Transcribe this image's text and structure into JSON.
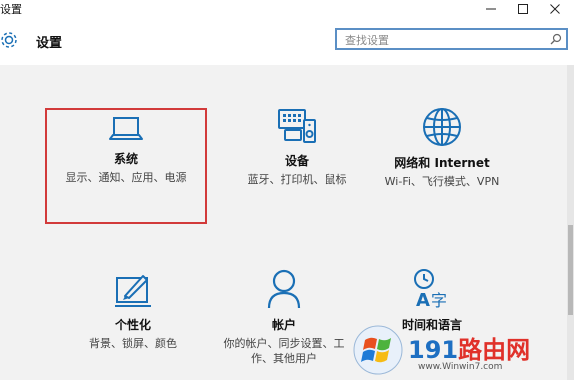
{
  "window": {
    "title": "设置",
    "minimize_icon": "minimize-icon",
    "maximize_icon": "maximize-icon",
    "close_icon": "close-icon"
  },
  "header": {
    "icon": "gear-icon",
    "title": "设置"
  },
  "search": {
    "placeholder": "查找设置",
    "icon": "search-icon",
    "border_color": "#5b8fc5"
  },
  "accent": "#1a6fb5",
  "tiles": [
    {
      "icon": "laptop-icon",
      "label": "系统",
      "desc": "显示、通知、应用、电源",
      "highlighted": true,
      "highlight_color": "#d23a3a"
    },
    {
      "icon": "devices-icon",
      "label": "设备",
      "desc": "蓝牙、打印机、鼠标"
    },
    {
      "icon": "globe-icon",
      "label": "网络和 Internet",
      "desc": "Wi-Fi、飞行模式、VPN"
    },
    {
      "icon": "personalize-icon",
      "label": "个性化",
      "desc": "背景、锁屏、颜色"
    },
    {
      "icon": "person-icon",
      "label": "帐户",
      "desc": "你的帐户、同步设置、工作、其他用户"
    },
    {
      "icon": "time-language-icon",
      "label": "时间和语言",
      "desc": ""
    }
  ],
  "watermark": {
    "text": "191路由网",
    "url": "www.Winwin7.com",
    "logo": "windows-logo-icon"
  }
}
